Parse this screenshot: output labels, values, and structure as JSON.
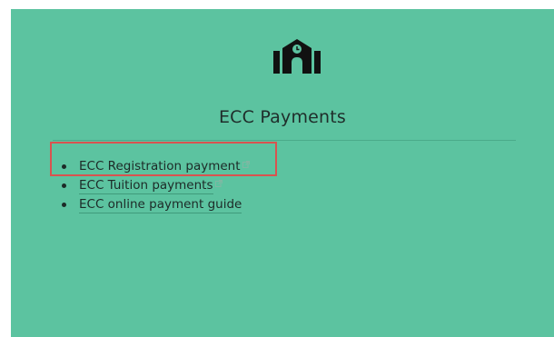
{
  "header": {
    "icon": "school-icon",
    "title": "ECC Payments"
  },
  "links": [
    {
      "label": "ECC Registration payment",
      "external": true,
      "icon": "external-link-icon"
    },
    {
      "label": "ECC Tuition payments",
      "external": true,
      "icon": "external-link-icon"
    },
    {
      "label": "ECC online payment guide",
      "external": false
    }
  ],
  "colors": {
    "card_background": "#5cc3a0",
    "highlight_border": "#d9534f",
    "text": "#1d2a27"
  }
}
